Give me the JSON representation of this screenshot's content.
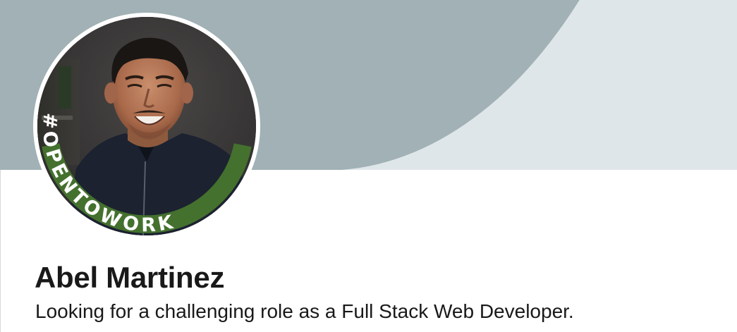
{
  "profile": {
    "name": "Abel Martinez",
    "headline": "Looking for a challenging role as a Full Stack Web Developer.",
    "open_to_work_badge": "#OPENTOWORK"
  },
  "colors": {
    "banner_background": "#dfe6e9",
    "banner_shape": "#a1b1b5",
    "open_to_work_green": "#44712e",
    "text_primary": "#191919"
  },
  "icons": {
    "avatar": "profile-photo"
  }
}
